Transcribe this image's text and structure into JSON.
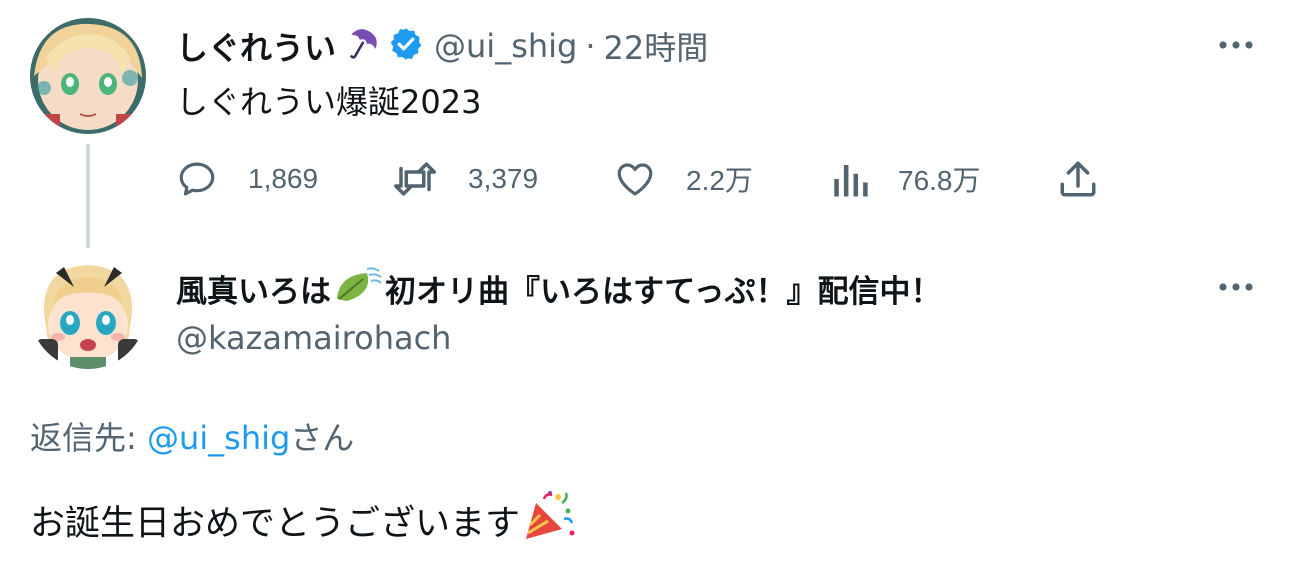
{
  "tweet": {
    "author": {
      "display_name": "しぐれうい",
      "name_emoji": "umbrella-emoji",
      "verified": true,
      "handle": "@ui_shig",
      "separator": "·",
      "time": "22時間"
    },
    "text": "しぐれうい爆誕2023",
    "actions": {
      "replies": "1,869",
      "retweets": "3,379",
      "likes": "2.2万",
      "views": "76.8万"
    },
    "icons": {
      "reply": "speech-bubble-icon",
      "retweet": "retweet-icon",
      "like": "heart-icon",
      "views": "bar-chart-icon",
      "share": "share-icon",
      "more": "more-dots-icon"
    }
  },
  "reply": {
    "author": {
      "display_name_prefix": "風真いろは",
      "name_emoji": "leaf-emoji",
      "display_name_suffix": "初オリ曲『いろはすてっぷ！』配信中！",
      "handle": "@kazamairohach"
    },
    "reply_to_label": "返信先: ",
    "reply_to_mention": "@ui_shig",
    "reply_to_suffix": "さん",
    "text": "お誕生日おめでとうございます",
    "text_emoji": "party-popper-emoji"
  },
  "colors": {
    "text_primary": "#0f1419",
    "text_secondary": "#536471",
    "accent": "#1d9bf0",
    "thread_line": "#cfd9de",
    "verified_badge": "#1d9bf0"
  }
}
